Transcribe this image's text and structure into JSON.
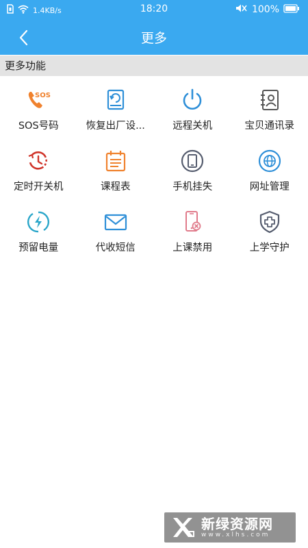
{
  "status_bar": {
    "sim_icon": "sim-card-icon",
    "wifi_icon": "wifi-icon",
    "network_speed": "1.4KB/s",
    "time": "18:20",
    "mute_icon": "speaker-mute-icon",
    "battery_percent": "100%",
    "battery_icon": "battery-icon"
  },
  "nav": {
    "back_icon": "chevron-left-icon",
    "title": "更多"
  },
  "section": {
    "title": "更多功能"
  },
  "features": [
    {
      "label": "SOS号码",
      "icon": "sos-phone-icon",
      "color": "#f0822e"
    },
    {
      "label": "恢复出厂设...",
      "icon": "factory-reset-icon",
      "color": "#2e8fd8"
    },
    {
      "label": "远程关机",
      "icon": "power-icon",
      "color": "#2e8fd8"
    },
    {
      "label": "宝贝通讯录",
      "icon": "contacts-icon",
      "color": "#555555"
    },
    {
      "label": "定时开关机",
      "icon": "timer-icon",
      "color": "#d0352b"
    },
    {
      "label": "课程表",
      "icon": "calendar-icon",
      "color": "#f0822e"
    },
    {
      "label": "手机挂失",
      "icon": "phone-lost-icon",
      "color": "#555c6e"
    },
    {
      "label": "网址管理",
      "icon": "globe-icon",
      "color": "#2e8fd8"
    },
    {
      "label": "预留电量",
      "icon": "battery-charge-icon",
      "color": "#2aa6c9"
    },
    {
      "label": "代收短信",
      "icon": "envelope-icon",
      "color": "#2e8fd8"
    },
    {
      "label": "上课禁用",
      "icon": "phone-disabled-icon",
      "color": "#e07a8a"
    },
    {
      "label": "上学守护",
      "icon": "shield-plus-icon",
      "color": "#555c6e"
    }
  ],
  "watermark": {
    "name": "新绿资源网",
    "url": "www.xlhs.com"
  }
}
